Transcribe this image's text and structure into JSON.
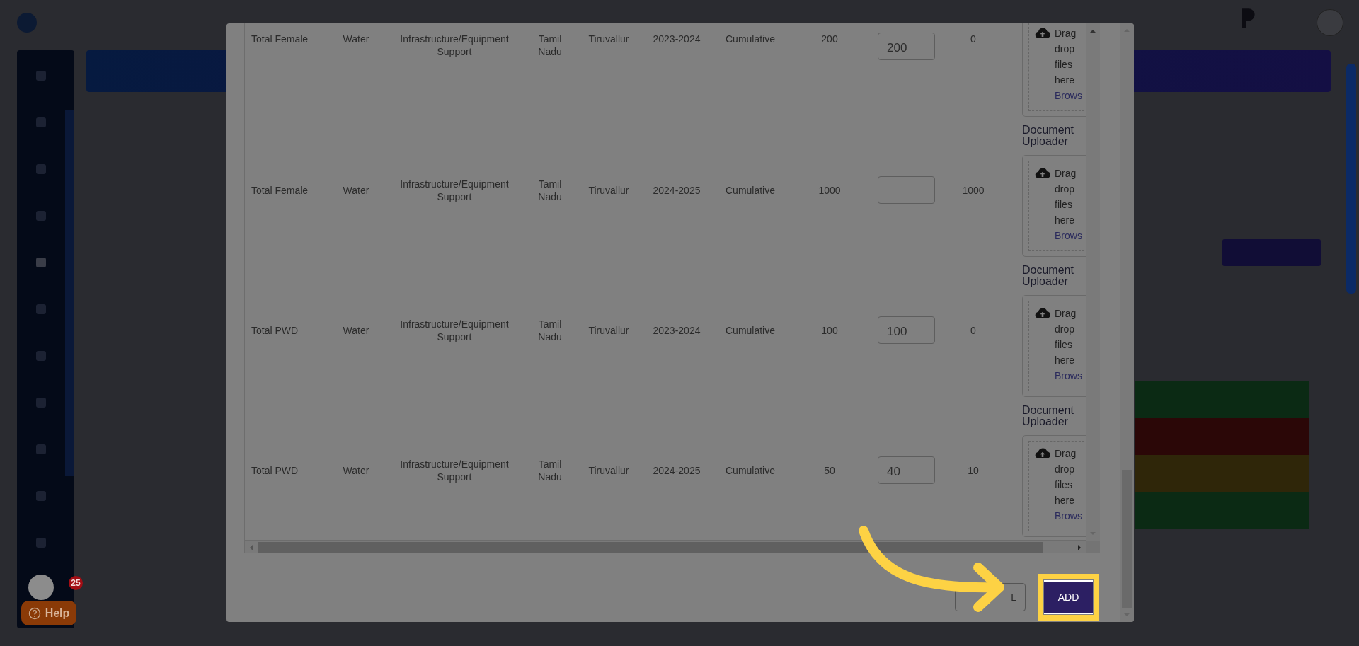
{
  "page": {
    "notification_badge": "25",
    "help_button": {
      "label": "Help"
    },
    "status_rows": [
      {
        "color": "#0b2a14"
      },
      {
        "color": "#2b0707"
      },
      {
        "color": "#2f2609"
      },
      {
        "color": "#0b2a14"
      }
    ]
  },
  "modal": {
    "rows": [
      {
        "activity": "Total Female",
        "sector": "Water",
        "thrust_area": "Infrastructure/Equipment Support",
        "state": "Tamil Nadu",
        "district": "Tiruvallur",
        "year": "2023-2024",
        "type": "Cumulative",
        "target": "200",
        "actual": "200",
        "balance": "0",
        "uploader": {
          "hint": [
            "Drag",
            "drop",
            "files",
            "here"
          ],
          "link": "Brows"
        }
      },
      {
        "activity": "Total Female",
        "sector": "Water",
        "thrust_area": "Infrastructure/Equipment Support",
        "state": "Tamil Nadu",
        "district": "Tiruvallur",
        "year": "2024-2025",
        "type": "Cumulative",
        "target": "1000",
        "balance": "1000",
        "uploader": {
          "label": "Document Uploader",
          "hint": [
            "Drag",
            "drop",
            "files",
            "here"
          ],
          "link": "Brows"
        }
      },
      {
        "activity": "Total PWD",
        "sector": "Water",
        "thrust_area": "Infrastructure/Equipment Support",
        "state": "Tamil Nadu",
        "district": "Tiruvallur",
        "year": "2023-2024",
        "type": "Cumulative",
        "target": "100",
        "actual": "100",
        "balance": "0",
        "uploader": {
          "label": "Document Uploader",
          "hint": [
            "Drag",
            "drop",
            "files",
            "here"
          ],
          "link": "Brows"
        }
      },
      {
        "activity": "Total PWD",
        "sector": "Water",
        "thrust_area": "Infrastructure/Equipment Support",
        "state": "Tamil Nadu",
        "district": "Tiruvallur",
        "year": "2024-2025",
        "type": "Cumulative",
        "target": "50",
        "actual": "40",
        "balance": "10",
        "uploader": {
          "label": "Document Uploader",
          "hint": [
            "Drag",
            "drop",
            "files",
            "here"
          ],
          "link": "Brows"
        }
      }
    ],
    "buttons": [
      {
        "kind": "cancel",
        "label": "L",
        "highlighted": false
      },
      {
        "kind": "primary",
        "label": "ADD",
        "highlighted": true
      }
    ]
  }
}
